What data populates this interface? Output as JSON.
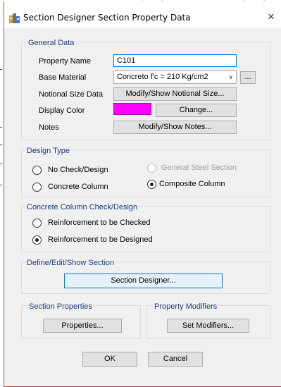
{
  "dialog": {
    "title": "Section Designer Section Property Data",
    "close_glyph": "×"
  },
  "general_data": {
    "group_label": "General Data",
    "property_name_label": "Property Name",
    "property_name_value": "C101",
    "base_material_label": "Base Material",
    "base_material_value": "Concreto f'c = 210 Kg/cm2",
    "base_material_more": "...",
    "notional_size_label": "Notional Size Data",
    "notional_size_button": "Modify/Show Notional Size...",
    "display_color_label": "Display Color",
    "display_color_value": "#ff00ff",
    "change_button": "Change...",
    "notes_label": "Notes",
    "notes_button": "Modify/Show Notes..."
  },
  "design_type": {
    "group_label": "Design Type",
    "options": [
      {
        "label": "No Check/Design",
        "checked": false,
        "enabled": true
      },
      {
        "label": "Concrete Column",
        "checked": false,
        "enabled": true
      },
      {
        "label": "General Steel Section",
        "checked": false,
        "enabled": false
      },
      {
        "label": "Composite Column",
        "checked": true,
        "enabled": true
      }
    ]
  },
  "concrete_column": {
    "group_label": "Concrete Column Check/Design",
    "options": [
      {
        "label": "Reinforcement to be Checked",
        "checked": false
      },
      {
        "label": "Reinforcement to be Designed",
        "checked": true
      }
    ]
  },
  "define_section": {
    "group_label": "Define/Edit/Show Section",
    "button": "Section Designer..."
  },
  "section_properties": {
    "group_label": "Section Properties",
    "button": "Properties..."
  },
  "property_modifiers": {
    "group_label": "Property Modifiers",
    "button": "Set Modifiers..."
  },
  "footer": {
    "ok": "OK",
    "cancel": "Cancel"
  },
  "icons": {
    "app_icon": "etabs-app-icon",
    "dropdown": "chevron-down-icon",
    "close": "close-icon"
  }
}
